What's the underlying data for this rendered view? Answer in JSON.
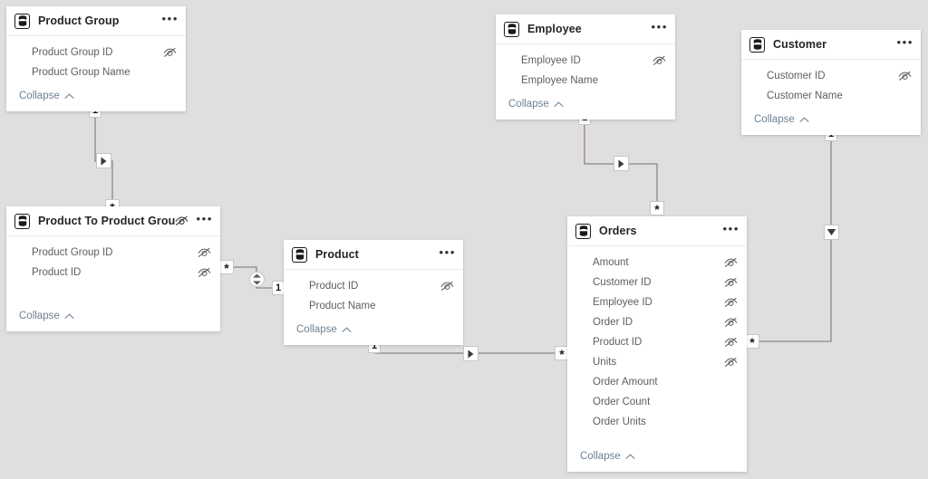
{
  "view": {
    "name": "model-view",
    "canvas_background": "#e0dfde",
    "card_background": "#ffffff",
    "collapse_link_color": "#6e8193",
    "field_text_color": "#605e5c",
    "title_text_color": "#252423",
    "relationship_line_color": "#8a8886"
  },
  "icons": {
    "table": "table-icon",
    "hidden": "hidden-eye-icon",
    "more": "more-options-icon",
    "collapse_chevron": "chevron-up-icon",
    "arrow_right": "filter-direction-right-icon",
    "arrow_down": "filter-direction-down-icon",
    "arrow_both": "filter-direction-both-icon"
  },
  "labels": {
    "collapse": "Collapse",
    "more": "•••",
    "one": "1",
    "many": "*"
  },
  "tables": [
    {
      "id": "product-group",
      "name": "Product Group",
      "hidden": false,
      "fields": [
        {
          "name": "Product Group ID",
          "hidden": true
        },
        {
          "name": "Product Group Name",
          "hidden": false
        }
      ]
    },
    {
      "id": "employee",
      "name": "Employee",
      "hidden": false,
      "fields": [
        {
          "name": "Employee ID",
          "hidden": true
        },
        {
          "name": "Employee Name",
          "hidden": false
        }
      ]
    },
    {
      "id": "customer",
      "name": "Customer",
      "hidden": false,
      "fields": [
        {
          "name": "Customer ID",
          "hidden": true
        },
        {
          "name": "Customer Name",
          "hidden": false
        }
      ]
    },
    {
      "id": "product-to-product-group",
      "name": "Product To Product Group",
      "hidden": true,
      "fields": [
        {
          "name": "Product Group ID",
          "hidden": true
        },
        {
          "name": "Product ID",
          "hidden": true
        }
      ]
    },
    {
      "id": "product",
      "name": "Product",
      "hidden": false,
      "fields": [
        {
          "name": "Product ID",
          "hidden": true
        },
        {
          "name": "Product Name",
          "hidden": false
        }
      ]
    },
    {
      "id": "orders",
      "name": "Orders",
      "hidden": false,
      "fields": [
        {
          "name": "Amount",
          "hidden": true
        },
        {
          "name": "Customer ID",
          "hidden": true
        },
        {
          "name": "Employee ID",
          "hidden": true
        },
        {
          "name": "Order ID",
          "hidden": true
        },
        {
          "name": "Product ID",
          "hidden": true
        },
        {
          "name": "Units",
          "hidden": true
        },
        {
          "name": "Order Amount",
          "hidden": false
        },
        {
          "name": "Order Count",
          "hidden": false
        },
        {
          "name": "Order Units",
          "hidden": false
        }
      ]
    }
  ],
  "relationships": [
    {
      "id": "product-group-to-bridge",
      "from_table": "Product Group",
      "to_table": "Product To Product Group",
      "from_cardinality": "1",
      "to_cardinality": "*",
      "cross_filter_direction": "single"
    },
    {
      "id": "bridge-to-product",
      "from_table": "Product To Product Group",
      "to_table": "Product",
      "from_cardinality": "*",
      "to_cardinality": "1",
      "cross_filter_direction": "both"
    },
    {
      "id": "product-to-orders",
      "from_table": "Product",
      "to_table": "Orders",
      "from_cardinality": "1",
      "to_cardinality": "*",
      "cross_filter_direction": "single"
    },
    {
      "id": "employee-to-orders",
      "from_table": "Employee",
      "to_table": "Orders",
      "from_cardinality": "1",
      "to_cardinality": "*",
      "cross_filter_direction": "single"
    },
    {
      "id": "customer-to-orders",
      "from_table": "Customer",
      "to_table": "Orders",
      "from_cardinality": "1",
      "to_cardinality": "*",
      "cross_filter_direction": "single"
    }
  ]
}
